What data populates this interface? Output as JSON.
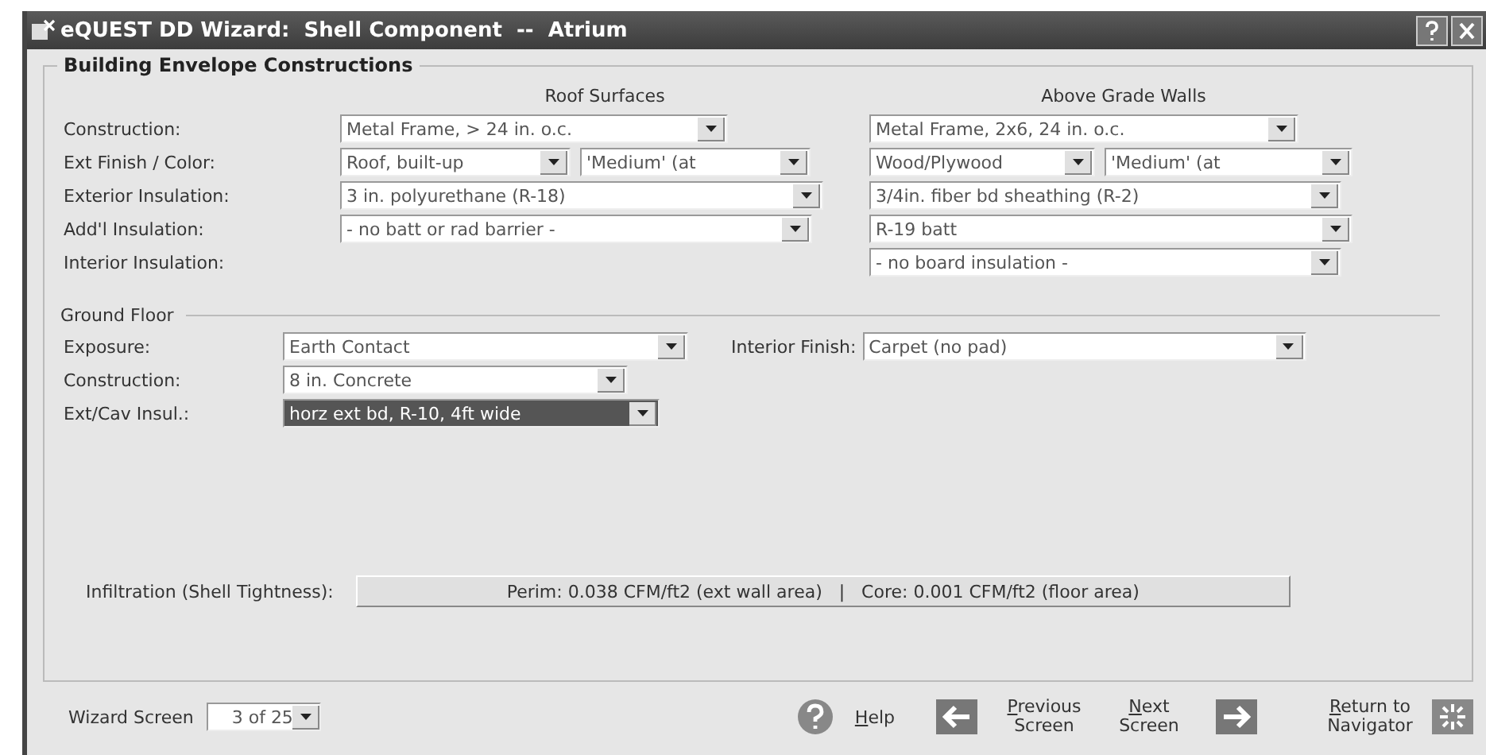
{
  "window": {
    "title": "eQUEST DD Wizard:  Shell Component  --  Atrium"
  },
  "envelope": {
    "title": "Building Envelope Constructions",
    "columns": [
      "Roof Surfaces",
      "Above Grade Walls"
    ],
    "rows": [
      {
        "label": "Construction:",
        "roof": {
          "kind": "short",
          "values": [
            "Metal Frame, > 24 in. o.c."
          ]
        },
        "walls": {
          "kind": "short",
          "values": [
            "Metal Frame, 2x6, 24 in. o.c."
          ]
        }
      },
      {
        "label": "Ext Finish / Color:",
        "roof": {
          "kind": "split",
          "values": [
            "Roof, built-up",
            "'Medium' (at"
          ]
        },
        "walls": {
          "kind": "split",
          "values": [
            "Wood/Plywood",
            "'Medium' (at"
          ]
        }
      },
      {
        "label": "Exterior Insulation:",
        "roof": {
          "kind": "full",
          "values": [
            "3 in. polyurethane (R-18)"
          ]
        },
        "walls": {
          "kind": "full",
          "values": [
            "3/4in. fiber bd sheathing (R-2)"
          ]
        }
      },
      {
        "label": "Add'l Insulation:",
        "roof": {
          "kind": "full",
          "values": [
            "- no batt or rad barrier -"
          ]
        },
        "walls": {
          "kind": "full",
          "values": [
            "R-19 batt"
          ]
        }
      },
      {
        "label": "Interior Insulation:",
        "walls": {
          "kind": "full",
          "values": [
            "- no board insulation -"
          ]
        }
      }
    ]
  },
  "ground_floor": {
    "title": "Ground Floor",
    "rows": [
      {
        "fields": [
          {
            "label": "Exposure:",
            "value": "Earth Contact",
            "kind": "wide",
            "highlighted": false
          },
          {
            "label": "Interior Finish:",
            "value": "Carpet (no pad)",
            "kind": "full",
            "highlighted": false
          }
        ]
      },
      {
        "fields": [
          {
            "label": "Construction:",
            "value": "8 in. Concrete",
            "kind": "narrow",
            "highlighted": false
          }
        ]
      },
      {
        "fields": [
          {
            "label": "Ext/Cav Insul.:",
            "value": "horz ext bd, R-10, 4ft wide",
            "kind": "medium",
            "highlighted": true
          }
        ]
      }
    ]
  },
  "infiltration": {
    "label": "Infiltration (Shell Tightness):",
    "value": "Perim: 0.038 CFM/ft2 (ext wall area)   |   Core: 0.001 CFM/ft2 (floor area)"
  },
  "footer": {
    "screen_label": "Wizard Screen",
    "screen_value": "3 of 25",
    "help": "Help",
    "previous": "Previous Screen",
    "next": "Next Screen",
    "navigator": "Return to Navigator"
  }
}
